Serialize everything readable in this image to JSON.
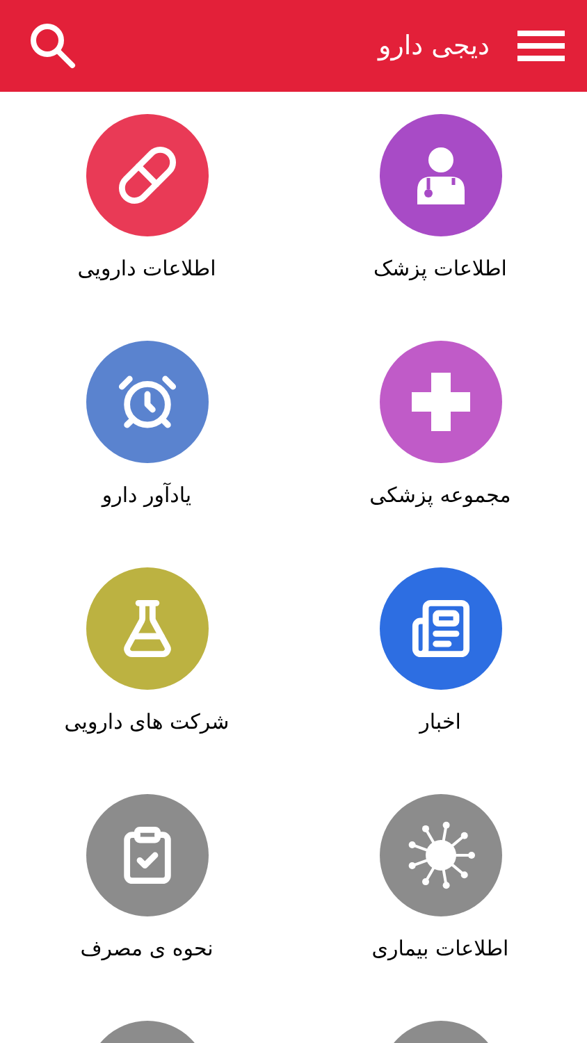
{
  "header": {
    "title": "دیجی دارو"
  },
  "items": [
    {
      "kind": "tile",
      "label": "اطلاعات پزشک",
      "color": "#a84bc6"
    },
    {
      "kind": "tile",
      "label": "اطلاعات دارویی",
      "color": "#e93a56"
    },
    {
      "kind": "tile",
      "label": "مجموعه پزشکی",
      "color": "#c05bc8"
    },
    {
      "kind": "tile",
      "label": "یادآور دارو",
      "color": "#5a83cf"
    },
    {
      "kind": "tile",
      "label": "اخبار",
      "color": "#2d6ee2"
    },
    {
      "kind": "tile",
      "label": "شرکت های دارویی",
      "color": "#bcb241"
    },
    {
      "kind": "tile",
      "label": "اطلاعات بیماری",
      "color": "#8c8c8c"
    },
    {
      "kind": "tile",
      "label": "نحوه ی مصرف",
      "color": "#8c8c8c"
    },
    {
      "kind": "partial",
      "color": "#8c8c8c"
    },
    {
      "kind": "partial",
      "color": "#8c8c8c"
    }
  ]
}
